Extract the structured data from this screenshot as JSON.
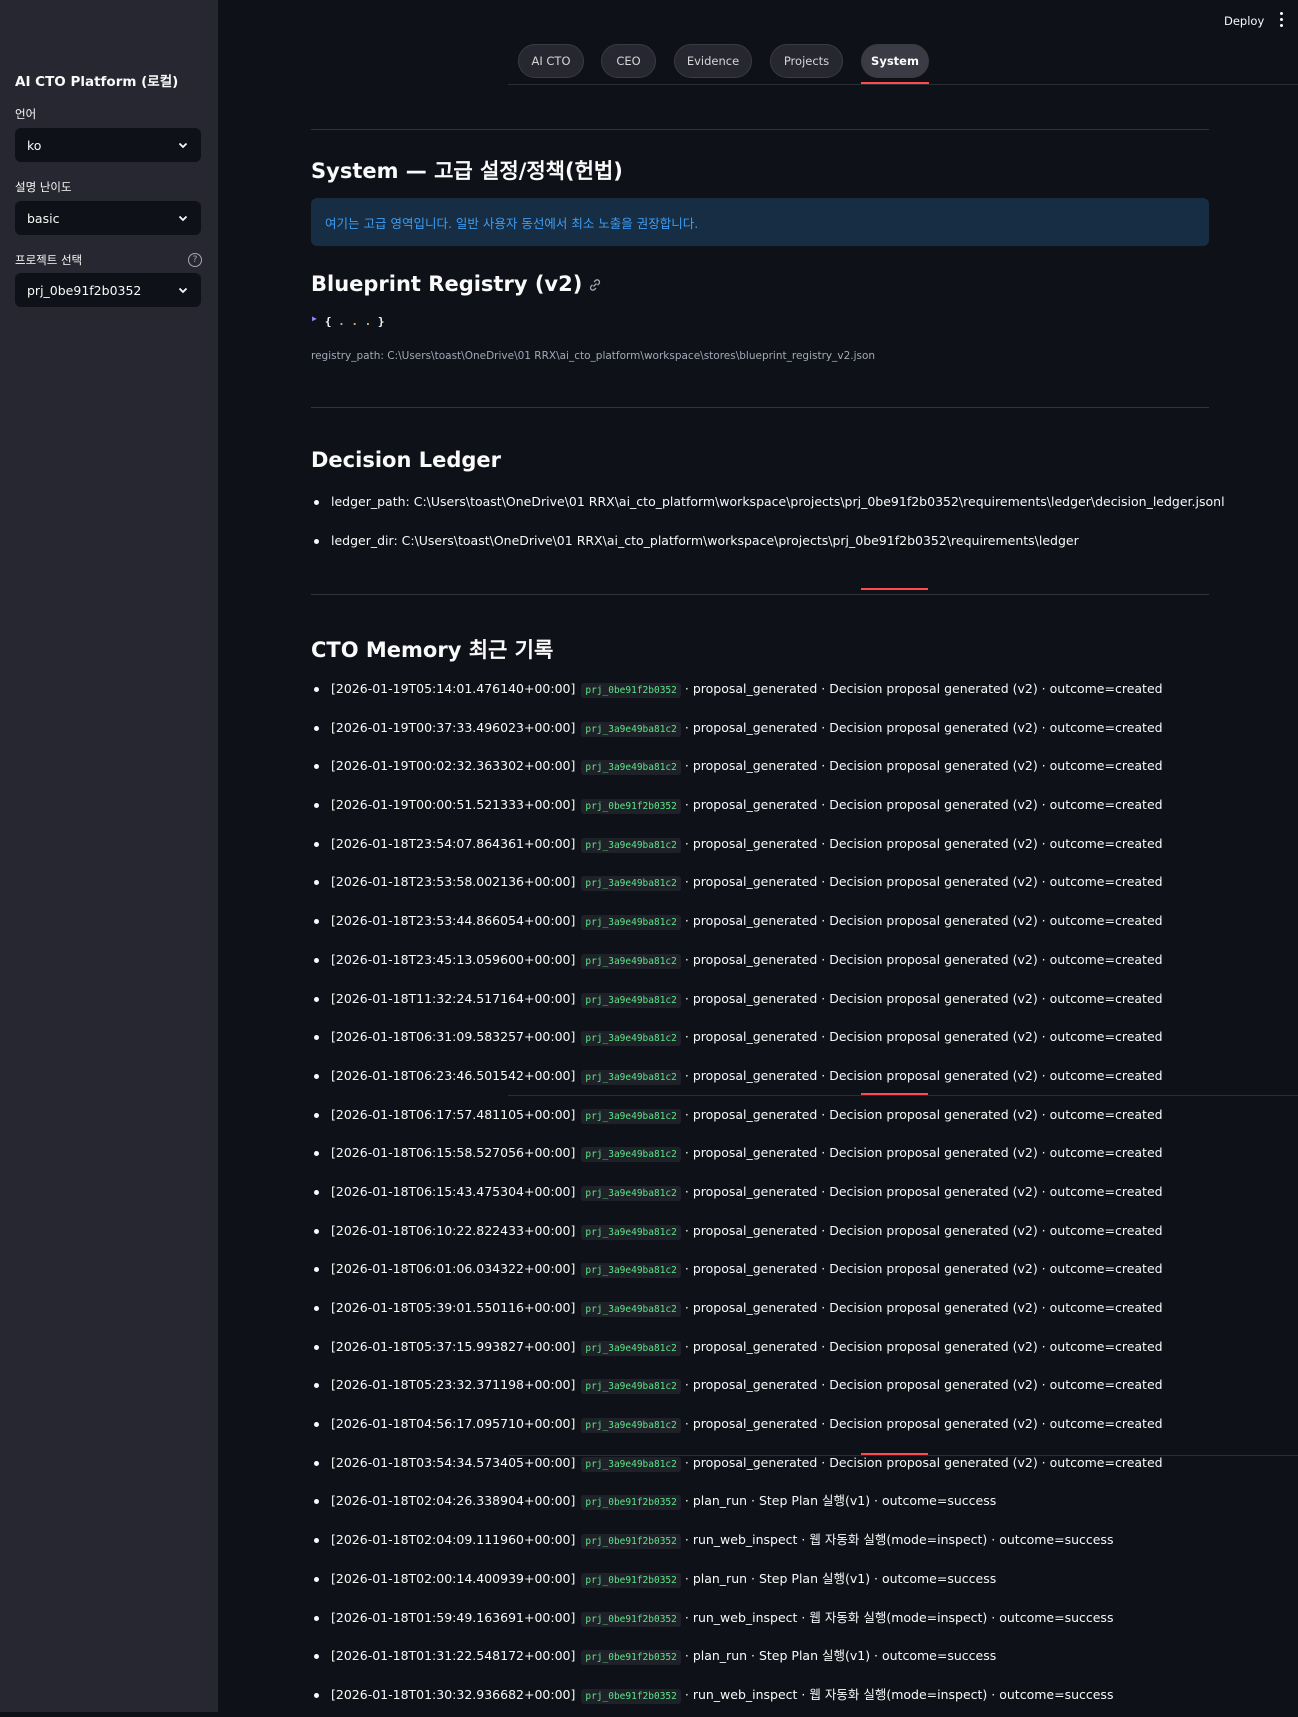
{
  "sidebar": {
    "title": "AI CTO Platform (로컬)",
    "language_label": "언어",
    "language_value": "ko",
    "difficulty_label": "설명 난이도",
    "difficulty_value": "basic",
    "project_label": "프로젝트 선택",
    "project_value": "prj_0be91f2b0352"
  },
  "header": {
    "deploy_label": "Deploy"
  },
  "tabs": [
    {
      "label": "AI CTO"
    },
    {
      "label": "CEO"
    },
    {
      "label": "Evidence"
    },
    {
      "label": "Projects"
    },
    {
      "label": "System"
    }
  ],
  "active_tab": "System",
  "main": {
    "title": "System — 고급 설정/정책(헌법)",
    "info": "여기는 고급 영역입니다. 일반 사용자 동선에서 최소 노출을 권장합니다.",
    "blueprint": {
      "heading": "Blueprint Registry (v2)",
      "json_collapsed": "{...}",
      "registry_path": "registry_path: C:\\Users\\toast\\OneDrive\\01 RRX\\ai_cto_platform\\workspace\\stores\\blueprint_registry_v2.json"
    },
    "ledger": {
      "heading": "Decision Ledger",
      "items": [
        "ledger_path: C:\\Users\\toast\\OneDrive\\01 RRX\\ai_cto_platform\\workspace\\projects\\prj_0be91f2b0352\\requirements\\ledger\\decision_ledger.jsonl",
        "ledger_dir: C:\\Users\\toast\\OneDrive\\01 RRX\\ai_cto_platform\\workspace\\projects\\prj_0be91f2b0352\\requirements\\ledger"
      ]
    },
    "memory": {
      "heading": "CTO Memory 최근 기록",
      "items": [
        {
          "ts": "[2026-01-19T05:14:01.476140+00:00]",
          "proj": "prj_0be91f2b0352",
          "rest": "· proposal_generated · Decision proposal generated (v2) · outcome=created"
        },
        {
          "ts": "[2026-01-19T00:37:33.496023+00:00]",
          "proj": "prj_3a9e49ba81c2",
          "rest": "· proposal_generated · Decision proposal generated (v2) · outcome=created"
        },
        {
          "ts": "[2026-01-19T00:02:32.363302+00:00]",
          "proj": "prj_3a9e49ba81c2",
          "rest": "· proposal_generated · Decision proposal generated (v2) · outcome=created"
        },
        {
          "ts": "[2026-01-19T00:00:51.521333+00:00]",
          "proj": "prj_0be91f2b0352",
          "rest": "· proposal_generated · Decision proposal generated (v2) · outcome=created"
        },
        {
          "ts": "[2026-01-18T23:54:07.864361+00:00]",
          "proj": "prj_3a9e49ba81c2",
          "rest": "· proposal_generated · Decision proposal generated (v2) · outcome=created"
        },
        {
          "ts": "[2026-01-18T23:53:58.002136+00:00]",
          "proj": "prj_3a9e49ba81c2",
          "rest": "· proposal_generated · Decision proposal generated (v2) · outcome=created"
        },
        {
          "ts": "[2026-01-18T23:53:44.866054+00:00]",
          "proj": "prj_3a9e49ba81c2",
          "rest": "· proposal_generated · Decision proposal generated (v2) · outcome=created"
        },
        {
          "ts": "[2026-01-18T23:45:13.059600+00:00]",
          "proj": "prj_3a9e49ba81c2",
          "rest": "· proposal_generated · Decision proposal generated (v2) · outcome=created"
        },
        {
          "ts": "[2026-01-18T11:32:24.517164+00:00]",
          "proj": "prj_3a9e49ba81c2",
          "rest": "· proposal_generated · Decision proposal generated (v2) · outcome=created"
        },
        {
          "ts": "[2026-01-18T06:31:09.583257+00:00]",
          "proj": "prj_3a9e49ba81c2",
          "rest": "· proposal_generated · Decision proposal generated (v2) · outcome=created"
        },
        {
          "ts": "[2026-01-18T06:23:46.501542+00:00]",
          "proj": "prj_3a9e49ba81c2",
          "rest": "· proposal_generated · Decision proposal generated (v2) · outcome=created"
        },
        {
          "ts": "[2026-01-18T06:17:57.481105+00:00]",
          "proj": "prj_3a9e49ba81c2",
          "rest": "· proposal_generated · Decision proposal generated (v2) · outcome=created"
        },
        {
          "ts": "[2026-01-18T06:15:58.527056+00:00]",
          "proj": "prj_3a9e49ba81c2",
          "rest": "· proposal_generated · Decision proposal generated (v2) · outcome=created"
        },
        {
          "ts": "[2026-01-18T06:15:43.475304+00:00]",
          "proj": "prj_3a9e49ba81c2",
          "rest": "· proposal_generated · Decision proposal generated (v2) · outcome=created"
        },
        {
          "ts": "[2026-01-18T06:10:22.822433+00:00]",
          "proj": "prj_3a9e49ba81c2",
          "rest": "· proposal_generated · Decision proposal generated (v2) · outcome=created"
        },
        {
          "ts": "[2026-01-18T06:01:06.034322+00:00]",
          "proj": "prj_3a9e49ba81c2",
          "rest": "· proposal_generated · Decision proposal generated (v2) · outcome=created"
        },
        {
          "ts": "[2026-01-18T05:39:01.550116+00:00]",
          "proj": "prj_3a9e49ba81c2",
          "rest": "· proposal_generated · Decision proposal generated (v2) · outcome=created"
        },
        {
          "ts": "[2026-01-18T05:37:15.993827+00:00]",
          "proj": "prj_3a9e49ba81c2",
          "rest": "· proposal_generated · Decision proposal generated (v2) · outcome=created"
        },
        {
          "ts": "[2026-01-18T05:23:32.371198+00:00]",
          "proj": "prj_3a9e49ba81c2",
          "rest": "· proposal_generated · Decision proposal generated (v2) · outcome=created"
        },
        {
          "ts": "[2026-01-18T04:56:17.095710+00:00]",
          "proj": "prj_3a9e49ba81c2",
          "rest": "· proposal_generated · Decision proposal generated (v2) · outcome=created"
        },
        {
          "ts": "[2026-01-18T03:54:34.573405+00:00]",
          "proj": "prj_3a9e49ba81c2",
          "rest": "· proposal_generated · Decision proposal generated (v2) · outcome=created"
        },
        {
          "ts": "[2026-01-18T02:04:26.338904+00:00]",
          "proj": "prj_0be91f2b0352",
          "rest": "· plan_run · Step Plan 실행(v1) · outcome=success"
        },
        {
          "ts": "[2026-01-18T02:04:09.111960+00:00]",
          "proj": "prj_0be91f2b0352",
          "rest": "· run_web_inspect · 웹 자동화 실행(mode=inspect) · outcome=success"
        },
        {
          "ts": "[2026-01-18T02:00:14.400939+00:00]",
          "proj": "prj_0be91f2b0352",
          "rest": "· plan_run · Step Plan 실행(v1) · outcome=success"
        },
        {
          "ts": "[2026-01-18T01:59:49.163691+00:00]",
          "proj": "prj_0be91f2b0352",
          "rest": "· run_web_inspect · 웹 자동화 실행(mode=inspect) · outcome=success"
        },
        {
          "ts": "[2026-01-18T01:31:22.548172+00:00]",
          "proj": "prj_0be91f2b0352",
          "rest": "· plan_run · Step Plan 실행(v1) · outcome=success"
        },
        {
          "ts": "[2026-01-18T01:30:32.936682+00:00]",
          "proj": "prj_0be91f2b0352",
          "rest": "· run_web_inspect · 웹 자동화 실행(mode=inspect) · outcome=success"
        }
      ]
    }
  },
  "colors": {
    "background": "#0e1117",
    "sidebar": "#262730",
    "accent_red": "#ff4b4b",
    "info_bg": "#172d43",
    "info_text": "#3d9df3",
    "code_green": "#5ce488"
  }
}
